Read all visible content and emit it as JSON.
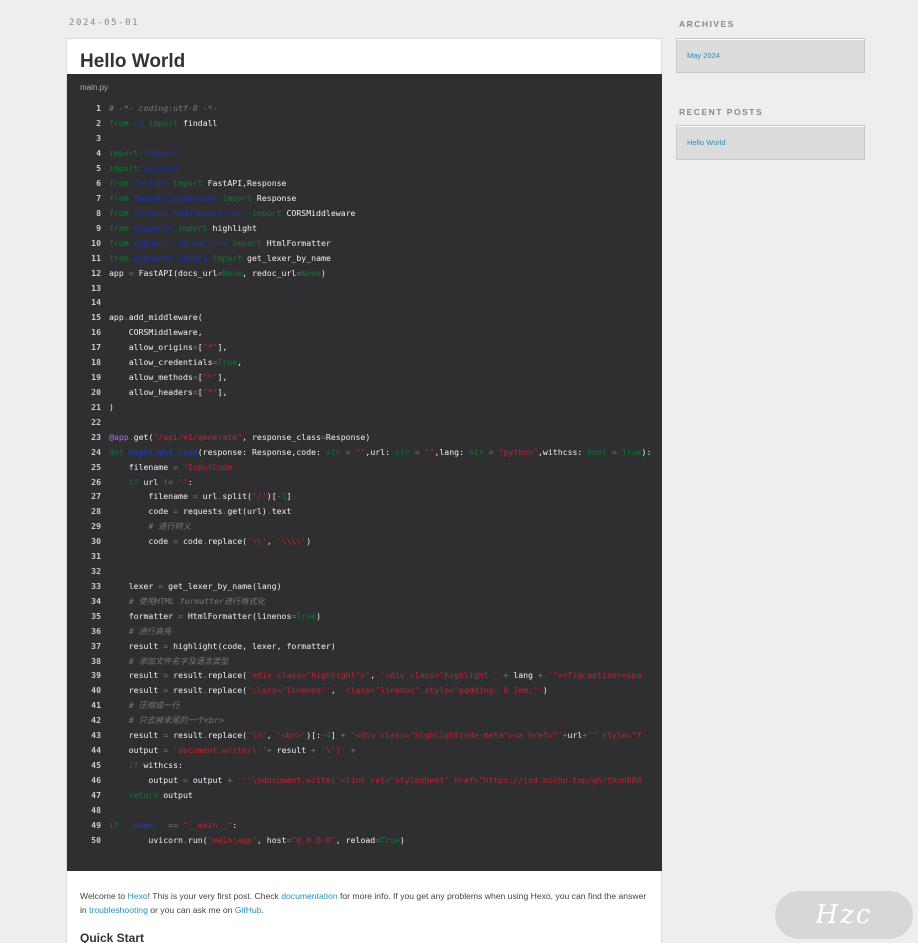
{
  "post": {
    "date": "2024-05-01",
    "title": "Hello World",
    "file_name": "main.py",
    "intro": {
      "t1": "Welcome to ",
      "l1": "Hexo",
      "t2": "! This is your very first post. Check ",
      "l2": "documentation",
      "t3": " for more info. If you get any problems when using Hexo, you can find the answer in ",
      "l3": "troubleshooting",
      "t4": " or you can ask me on ",
      "l4": "GitHub",
      "t5": "."
    },
    "quick_start": "Quick Start"
  },
  "code": [
    {
      "n": "1",
      "s": [
        [
          "c-com",
          "# -*- coding:utf-8 -*-"
        ]
      ]
    },
    {
      "n": "2",
      "s": [
        [
          "c-kw",
          "from"
        ],
        [
          "",
          " "
        ],
        [
          "c-mod",
          "re"
        ],
        [
          "",
          " "
        ],
        [
          "c-kw",
          "import"
        ],
        [
          "",
          " findall"
        ]
      ]
    },
    {
      "n": "3",
      "s": []
    },
    {
      "n": "4",
      "s": [
        [
          "c-kw",
          "import"
        ],
        [
          "",
          " "
        ],
        [
          "c-mod",
          "requests"
        ]
      ]
    },
    {
      "n": "5",
      "s": [
        [
          "c-kw",
          "import"
        ],
        [
          "",
          " "
        ],
        [
          "c-mod",
          "uvicorn"
        ]
      ]
    },
    {
      "n": "6",
      "s": [
        [
          "c-kw",
          "from"
        ],
        [
          "",
          " "
        ],
        [
          "c-mod",
          "fastapi"
        ],
        [
          "",
          " "
        ],
        [
          "c-kw",
          "import"
        ],
        [
          "",
          " FastAPI,Response"
        ]
      ]
    },
    {
      "n": "7",
      "s": [
        [
          "c-kw",
          "from"
        ],
        [
          "",
          " "
        ],
        [
          "c-mod",
          "fastapi.responses"
        ],
        [
          "",
          " "
        ],
        [
          "c-kw",
          "import"
        ],
        [
          "",
          " Response"
        ]
      ]
    },
    {
      "n": "8",
      "s": [
        [
          "c-kw",
          "from"
        ],
        [
          "",
          " "
        ],
        [
          "c-mod",
          "fastapi.middleware.cors"
        ],
        [
          "",
          " "
        ],
        [
          "c-kw",
          "import"
        ],
        [
          "",
          " CORSMiddleware"
        ]
      ]
    },
    {
      "n": "9",
      "s": [
        [
          "c-kw",
          "from"
        ],
        [
          "",
          " "
        ],
        [
          "c-mod",
          "pygments"
        ],
        [
          "",
          " "
        ],
        [
          "c-kw",
          "import"
        ],
        [
          "",
          " highlight"
        ]
      ]
    },
    {
      "n": "10",
      "s": [
        [
          "c-kw",
          "from"
        ],
        [
          "",
          " "
        ],
        [
          "c-mod",
          "pygments.formatters"
        ],
        [
          "",
          " "
        ],
        [
          "c-kw",
          "import"
        ],
        [
          "",
          " HtmlFormatter"
        ]
      ]
    },
    {
      "n": "11",
      "s": [
        [
          "c-kw",
          "from"
        ],
        [
          "",
          " "
        ],
        [
          "c-mod",
          "pygments.lexers"
        ],
        [
          "",
          " "
        ],
        [
          "c-kw",
          "import"
        ],
        [
          "",
          " get_lexer_by_name"
        ]
      ]
    },
    {
      "n": "12",
      "s": [
        [
          "",
          "app "
        ],
        [
          "c-op",
          "="
        ],
        [
          "",
          " FastAPI(docs_url"
        ],
        [
          "c-op",
          "="
        ],
        [
          "c-kw",
          "None"
        ],
        [
          "",
          ", redoc_url"
        ],
        [
          "c-op",
          "="
        ],
        [
          "c-kw",
          "None"
        ],
        [
          "",
          ")"
        ]
      ]
    },
    {
      "n": "13",
      "s": []
    },
    {
      "n": "14",
      "s": []
    },
    {
      "n": "15",
      "s": [
        [
          "",
          "app"
        ],
        [
          "c-op",
          "."
        ],
        [
          "",
          "add_middleware("
        ]
      ]
    },
    {
      "n": "16",
      "s": [
        [
          "",
          "    CORSMiddleware,"
        ]
      ]
    },
    {
      "n": "17",
      "s": [
        [
          "",
          "    allow_origins"
        ],
        [
          "c-op",
          "="
        ],
        [
          "",
          "["
        ],
        [
          "c-str",
          "\"*\""
        ],
        [
          "",
          "],"
        ]
      ]
    },
    {
      "n": "18",
      "s": [
        [
          "",
          "    allow_credentials"
        ],
        [
          "c-op",
          "="
        ],
        [
          "c-kw",
          "True"
        ],
        [
          "",
          ","
        ]
      ]
    },
    {
      "n": "19",
      "s": [
        [
          "",
          "    allow_methods"
        ],
        [
          "c-op",
          "="
        ],
        [
          "",
          "["
        ],
        [
          "c-str",
          "\"*\""
        ],
        [
          "",
          "],"
        ]
      ]
    },
    {
      "n": "20",
      "s": [
        [
          "",
          "    allow_headers"
        ],
        [
          "c-op",
          "="
        ],
        [
          "",
          "["
        ],
        [
          "c-str",
          "\"*\""
        ],
        [
          "",
          "],"
        ]
      ]
    },
    {
      "n": "21",
      "s": [
        [
          "",
          ")"
        ]
      ]
    },
    {
      "n": "22",
      "s": []
    },
    {
      "n": "23",
      "s": [
        [
          "c-dec",
          "@app"
        ],
        [
          "c-op",
          "."
        ],
        [
          "",
          "get("
        ],
        [
          "c-str",
          "\"/api/v1/generate\""
        ],
        [
          "",
          ", response_class"
        ],
        [
          "c-op",
          "="
        ],
        [
          "",
          "Response)"
        ]
      ]
    },
    {
      "n": "24",
      "s": [
        [
          "c-kw",
          "def"
        ],
        [
          "",
          " "
        ],
        [
          "c-fn",
          "highlight_code"
        ],
        [
          "",
          "(response: Response,code: "
        ],
        [
          "c-kw",
          "str"
        ],
        [
          "",
          " "
        ],
        [
          "c-op",
          "="
        ],
        [
          "",
          " "
        ],
        [
          "c-str",
          "\"\""
        ],
        [
          "",
          ",url: "
        ],
        [
          "c-kw",
          "str"
        ],
        [
          "",
          " "
        ],
        [
          "c-op",
          "="
        ],
        [
          "",
          " "
        ],
        [
          "c-str",
          "\"\""
        ],
        [
          "",
          ",lang: "
        ],
        [
          "c-kw",
          "str"
        ],
        [
          "",
          " "
        ],
        [
          "c-op",
          "="
        ],
        [
          "",
          " "
        ],
        [
          "c-str",
          "\"python\""
        ],
        [
          "",
          ",withcss: "
        ],
        [
          "c-kw",
          "bool"
        ],
        [
          "",
          " "
        ],
        [
          "c-op",
          "="
        ],
        [
          "",
          " "
        ],
        [
          "c-kw",
          "True"
        ],
        [
          "",
          "):"
        ]
      ]
    },
    {
      "n": "25",
      "s": [
        [
          "",
          "    filename "
        ],
        [
          "c-op",
          "="
        ],
        [
          "",
          " "
        ],
        [
          "c-str",
          "'InputCode'"
        ]
      ]
    },
    {
      "n": "26",
      "s": [
        [
          "",
          "    "
        ],
        [
          "c-kw",
          "if"
        ],
        [
          "",
          " url "
        ],
        [
          "c-op",
          "!="
        ],
        [
          "",
          " "
        ],
        [
          "c-str",
          "\"\""
        ],
        [
          "",
          ":"
        ]
      ]
    },
    {
      "n": "27",
      "s": [
        [
          "",
          "        filename "
        ],
        [
          "c-op",
          "="
        ],
        [
          "",
          " url"
        ],
        [
          "c-op",
          "."
        ],
        [
          "",
          "split("
        ],
        [
          "c-str",
          "'/'"
        ],
        [
          "",
          ")["
        ],
        [
          "c-op",
          "-"
        ],
        [
          "c-kw",
          "1"
        ],
        [
          "",
          "]"
        ]
      ]
    },
    {
      "n": "28",
      "s": [
        [
          "",
          "        code "
        ],
        [
          "c-op",
          "="
        ],
        [
          "",
          " requests"
        ],
        [
          "c-op",
          "."
        ],
        [
          "",
          "get(url)"
        ],
        [
          "c-op",
          "."
        ],
        [
          "",
          "text"
        ]
      ]
    },
    {
      "n": "29",
      "s": [
        [
          "",
          "        "
        ],
        [
          "c-com",
          "# 进行转义"
        ]
      ]
    },
    {
      "n": "30",
      "s": [
        [
          "",
          "        code "
        ],
        [
          "c-op",
          "="
        ],
        [
          "",
          " code"
        ],
        [
          "c-op",
          "."
        ],
        [
          "",
          "replace("
        ],
        [
          "c-str",
          "'\\\\'"
        ],
        [
          "",
          ", "
        ],
        [
          "c-str",
          "'\\\\\\\\'"
        ],
        [
          "",
          ")"
        ]
      ]
    },
    {
      "n": "31",
      "s": []
    },
    {
      "n": "32",
      "s": []
    },
    {
      "n": "33",
      "s": [
        [
          "",
          "    lexer "
        ],
        [
          "c-op",
          "="
        ],
        [
          "",
          " get_lexer_by_name(lang)"
        ]
      ]
    },
    {
      "n": "34",
      "s": [
        [
          "",
          "    "
        ],
        [
          "c-com",
          "# 使用HTML formatter进行格式化"
        ]
      ]
    },
    {
      "n": "35",
      "s": [
        [
          "",
          "    formatter "
        ],
        [
          "c-op",
          "="
        ],
        [
          "",
          " HtmlFormatter(linenos"
        ],
        [
          "c-op",
          "="
        ],
        [
          "c-kw",
          "True"
        ],
        [
          "",
          ")"
        ]
      ]
    },
    {
      "n": "36",
      "s": [
        [
          "",
          "    "
        ],
        [
          "c-com",
          "# 进行高亮"
        ]
      ]
    },
    {
      "n": "37",
      "s": [
        [
          "",
          "    result "
        ],
        [
          "c-op",
          "="
        ],
        [
          "",
          " highlight(code, lexer, formatter)"
        ]
      ]
    },
    {
      "n": "38",
      "s": [
        [
          "",
          "    "
        ],
        [
          "c-com",
          "# 添加文件名字及语言类型"
        ]
      ]
    },
    {
      "n": "39",
      "s": [
        [
          "",
          "    result "
        ],
        [
          "c-op",
          "="
        ],
        [
          "",
          " result"
        ],
        [
          "c-op",
          "."
        ],
        [
          "",
          "replace("
        ],
        [
          "c-str",
          "'<div class=\"highlight\">'"
        ],
        [
          "",
          ", "
        ],
        [
          "c-str",
          "'<div class=\"highlight '"
        ],
        [
          "",
          " "
        ],
        [
          "c-op",
          "+"
        ],
        [
          "",
          " lang "
        ],
        [
          "c-op",
          "+"
        ],
        [
          "",
          " "
        ],
        [
          "c-str",
          "'\"><figcaption><spa"
        ]
      ]
    },
    {
      "n": "40",
      "s": [
        [
          "",
          "    result "
        ],
        [
          "c-op",
          "="
        ],
        [
          "",
          " result"
        ],
        [
          "c-op",
          "."
        ],
        [
          "",
          "replace("
        ],
        [
          "c-str",
          "'class=\"linenos\"'"
        ],
        [
          "",
          ", "
        ],
        [
          "c-str",
          "'class=\"linenos\" style=\"padding: 0 1em;\"'"
        ],
        [
          "",
          ")"
        ]
      ]
    },
    {
      "n": "41",
      "s": [
        [
          "",
          "    "
        ],
        [
          "c-com",
          "# 压缩成一行"
        ]
      ]
    },
    {
      "n": "42",
      "s": [
        [
          "",
          "    "
        ],
        [
          "c-com",
          "# 只去掉末尾的一个<br>"
        ]
      ]
    },
    {
      "n": "43",
      "s": [
        [
          "",
          "    result "
        ],
        [
          "c-op",
          "="
        ],
        [
          "",
          " result"
        ],
        [
          "c-op",
          "."
        ],
        [
          "",
          "replace("
        ],
        [
          "c-str",
          "'\\n'"
        ],
        [
          "",
          ", "
        ],
        [
          "c-str",
          "'<br>'"
        ],
        [
          "",
          ")[:"
        ],
        [
          "c-op",
          "-"
        ],
        [
          "c-kw",
          "4"
        ],
        [
          "",
          "] "
        ],
        [
          "c-op",
          "+"
        ],
        [
          "",
          " "
        ],
        [
          "c-str",
          "'<div class=\"highlightcode-meta\"><a href=\"'"
        ],
        [
          "c-op",
          "+"
        ],
        [
          "",
          "url"
        ],
        [
          "c-op",
          "+"
        ],
        [
          "c-str",
          "'\" style=\"f"
        ]
      ]
    },
    {
      "n": "44",
      "s": [
        [
          "",
          "    output "
        ],
        [
          "c-op",
          "="
        ],
        [
          "",
          " "
        ],
        [
          "c-str",
          "'document.write(\\''"
        ],
        [
          "c-op",
          "+"
        ],
        [
          "",
          " result "
        ],
        [
          "c-op",
          "+"
        ],
        [
          "",
          " "
        ],
        [
          "c-str",
          "'\\')'"
        ],
        [
          "",
          " "
        ],
        [
          "c-op",
          "+"
        ]
      ]
    },
    {
      "n": "45",
      "s": [
        [
          "",
          "    "
        ],
        [
          "c-kw",
          "if"
        ],
        [
          "",
          " withcss:"
        ]
      ]
    },
    {
      "n": "46",
      "s": [
        [
          "",
          "        output "
        ],
        [
          "c-op",
          "="
        ],
        [
          "",
          " output "
        ],
        [
          "c-op",
          "+"
        ],
        [
          "",
          " "
        ],
        [
          "c-str",
          "'''\\ndocument.write('<link rel=\"stylesheet\" href=\"https://jsd.hzchu.top/gh/thun888"
        ]
      ]
    },
    {
      "n": "47",
      "s": [
        [
          "",
          "    "
        ],
        [
          "c-kw",
          "return"
        ],
        [
          "",
          " output"
        ]
      ]
    },
    {
      "n": "48",
      "s": []
    },
    {
      "n": "49",
      "s": [
        [
          "c-kw",
          "if"
        ],
        [
          "",
          " "
        ],
        [
          "c-fn",
          "__name__"
        ],
        [
          "",
          " "
        ],
        [
          "c-op",
          "=="
        ],
        [
          "",
          " "
        ],
        [
          "c-str",
          "\"__main__\""
        ],
        [
          "",
          ":"
        ]
      ]
    },
    {
      "n": "50",
      "s": [
        [
          "",
          "        uvicorn"
        ],
        [
          "c-op",
          "."
        ],
        [
          "",
          "run("
        ],
        [
          "c-str",
          "\"main:app\""
        ],
        [
          "",
          ", host"
        ],
        [
          "c-op",
          "="
        ],
        [
          "c-str",
          "\"0.0.0.0\""
        ],
        [
          "",
          ", reload"
        ],
        [
          "c-op",
          "="
        ],
        [
          "c-kw",
          "True"
        ],
        [
          "",
          ")"
        ]
      ]
    }
  ],
  "sidebar": {
    "archives_title": "ARCHIVES",
    "archives_item": "May 2024",
    "recent_title": "RECENT POSTS",
    "recent_item": "Hello World"
  },
  "watermark": "Hzc"
}
